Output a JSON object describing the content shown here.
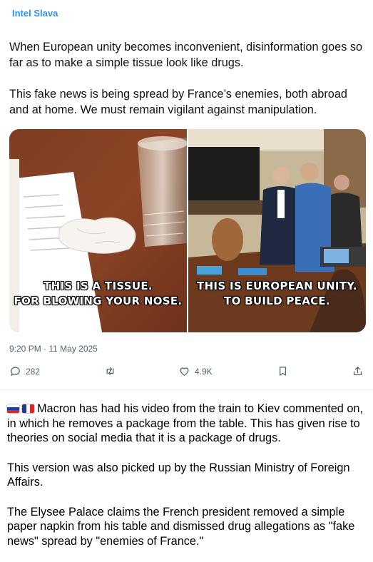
{
  "channel": {
    "name": "Intel Slava"
  },
  "tweet": {
    "paragraphs": [
      "When European unity becomes inconvenient, disinformation goes so far as to make a simple tissue look like drugs.",
      "This fake news is being spread by France’s enemies, both abroad and at home. We must remain vigilant against manipulation."
    ],
    "images": [
      {
        "caption_line1": "THIS IS A TISSUE.",
        "caption_line2": "FOR BLOWING YOUR NOSE."
      },
      {
        "caption_line1": "THIS IS EUROPEAN UNITY.",
        "caption_line2": "TO BUILD PEACE."
      }
    ],
    "timestamp": "9:20 PM · 11 May 2025",
    "actions": {
      "reply_count": "282",
      "like_count": "4.9K"
    }
  },
  "post": {
    "flags": [
      "flag-russia-icon",
      "flag-france-icon"
    ],
    "paragraph1": "Macron has had his video from the train to Kiev commented on, in which he removes a package from the table. This has given rise to theories on social media that it is a package of drugs.",
    "paragraph2": "This version was also picked up by the Russian Ministry of Foreign Affairs.",
    "paragraph3": "The Elysee Palace claims the French president removed a simple paper napkin from his table and dismissed drug allegations as \"fake news\" spread by \"enemies of France.\""
  },
  "colors": {
    "channel_name": "#3390ec",
    "muted": "#536471",
    "text": "#0f1419"
  }
}
